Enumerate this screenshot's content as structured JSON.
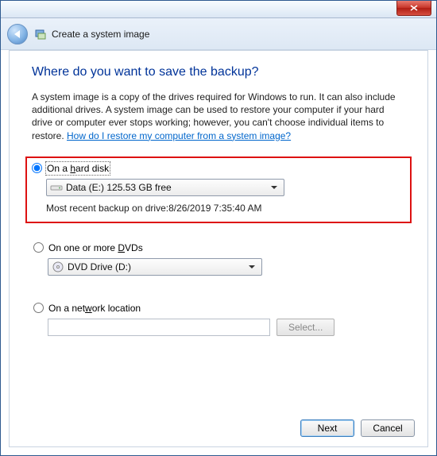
{
  "window": {
    "title": "Create a system image"
  },
  "heading": "Where do you want to save the backup?",
  "description": {
    "text": "A system image is a copy of the drives required for Windows to run. It can also include additional drives. A system image can be used to restore your computer if your hard drive or computer ever stops working; however, you can't choose individual items to restore. ",
    "link": "How do I restore my computer from a system image?"
  },
  "options": {
    "hard_disk": {
      "label_prefix": "On a ",
      "label_ul": "h",
      "label_suffix": "ard disk",
      "selected_drive": "Data (E:)  125.53 GB free",
      "recent_backup": "Most recent backup on drive:8/26/2019 7:35:40 AM",
      "checked": true
    },
    "dvd": {
      "label_prefix": "On one or more ",
      "label_ul": "D",
      "label_suffix": "VDs",
      "selected_drive": "DVD Drive (D:)",
      "checked": false
    },
    "network": {
      "label_prefix": "On a net",
      "label_ul": "w",
      "label_suffix": "ork location",
      "input_value": "",
      "select_label": "Select...",
      "checked": false
    }
  },
  "footer": {
    "next": "Next",
    "cancel": "Cancel"
  }
}
